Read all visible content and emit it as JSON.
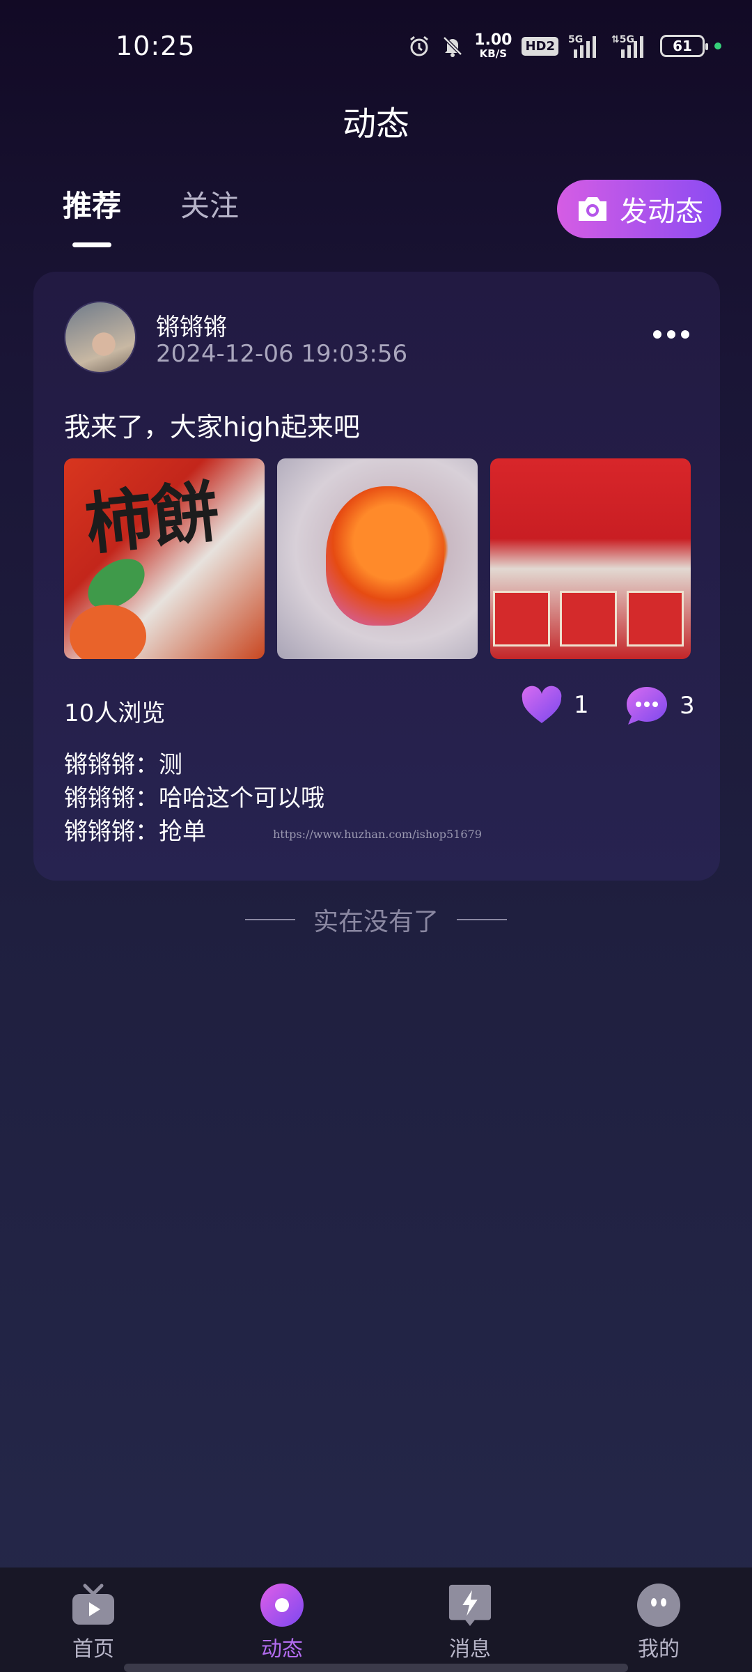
{
  "status_bar": {
    "time": "10:25",
    "net_speed_value": "1.00",
    "net_speed_unit": "KB/S",
    "hd_label": "HD2",
    "signal_1_label": "5G",
    "signal_2_label": "5G",
    "battery": "61"
  },
  "header": {
    "title": "动态"
  },
  "tabs": [
    {
      "label": "推荐",
      "active": true
    },
    {
      "label": "关注",
      "active": false
    }
  ],
  "post_button": {
    "label": "发动态",
    "icon": "camera-icon"
  },
  "post": {
    "user_name": "锵锵锵",
    "time": "2024-12-06 19:03:56",
    "text": "我来了，大家high起来吧",
    "photos": [
      {
        "text": "柿餅"
      },
      {
        "text": ""
      },
      {
        "text": ""
      }
    ],
    "views": "10人浏览",
    "likes": "1",
    "comments_count": "3",
    "comments": [
      {
        "text": "锵锵锵：测"
      },
      {
        "text": "锵锵锵：哈哈这个可以哦"
      },
      {
        "text": "锵锵锵：抢单"
      }
    ],
    "watermark": "https://www.huzhan.com/ishop51679"
  },
  "end_note": "实在没有了",
  "bottom_nav": [
    {
      "label": "首页",
      "icon": "tv-icon",
      "active": false
    },
    {
      "label": "动态",
      "icon": "circle-dot-icon",
      "active": true
    },
    {
      "label": "消息",
      "icon": "lightning-bubble-icon",
      "active": false
    },
    {
      "label": "我的",
      "icon": "face-icon",
      "active": false
    }
  ],
  "colors": {
    "accent_gradient_start": "#d55de4",
    "accent_gradient_end": "#8b4bf2",
    "active_nav": "#b36cf0"
  }
}
